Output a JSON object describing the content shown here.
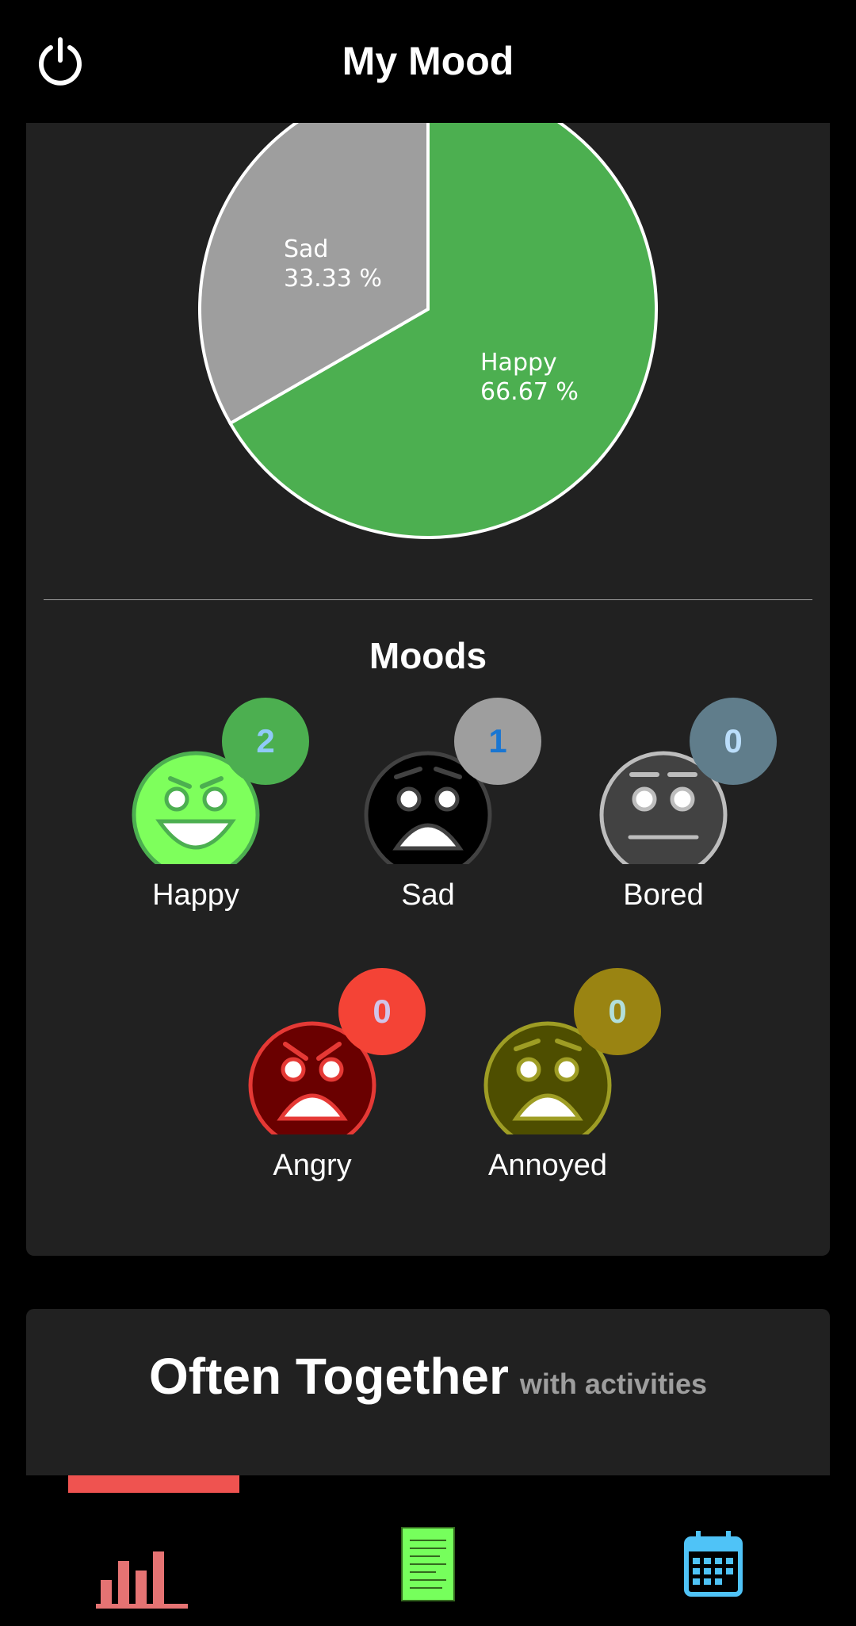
{
  "header": {
    "title": "My Mood",
    "power_icon": "power-icon"
  },
  "chart_data": {
    "type": "pie",
    "slices": [
      {
        "label": "Happy",
        "percent_text": "66.67 %",
        "value": 66.67,
        "color": "#4caf50"
      },
      {
        "label": "Sad",
        "percent_text": "33.33 %",
        "value": 33.33,
        "color": "#9e9e9e"
      }
    ]
  },
  "moods": {
    "title": "Moods",
    "items": [
      {
        "name": "Happy",
        "count": "2",
        "face_color": "#7eff5c",
        "face_stroke": "#4caf50",
        "badge_color": "#4caf50",
        "count_color": "#90caf9"
      },
      {
        "name": "Sad",
        "count": "1",
        "face_color": "#000000",
        "face_stroke": "#424242",
        "badge_color": "#9e9e9e",
        "count_color": "#1976d2"
      },
      {
        "name": "Bored",
        "count": "0",
        "face_color": "#424242",
        "face_stroke": "#bdbdbd",
        "badge_color": "#607d8b",
        "count_color": "#bbdefb"
      },
      {
        "name": "Angry",
        "count": "0",
        "face_color": "#6a0000",
        "face_stroke": "#e53935",
        "badge_color": "#f44336",
        "count_color": "#d1c4e9"
      },
      {
        "name": "Annoyed",
        "count": "0",
        "face_color": "#4e4e00",
        "face_stroke": "#9e9d24",
        "badge_color": "#9a8412",
        "count_color": "#b2dfdb"
      }
    ]
  },
  "often_together": {
    "title": "Often Together",
    "subtitle": "with activities"
  },
  "nav": {
    "items": [
      {
        "icon": "bar-chart-icon",
        "color": "#e57373",
        "active": true
      },
      {
        "icon": "notes-icon",
        "color": "#76ff5c",
        "active": false
      },
      {
        "icon": "calendar-icon",
        "color": "#4fc3f7",
        "active": false
      }
    ]
  }
}
